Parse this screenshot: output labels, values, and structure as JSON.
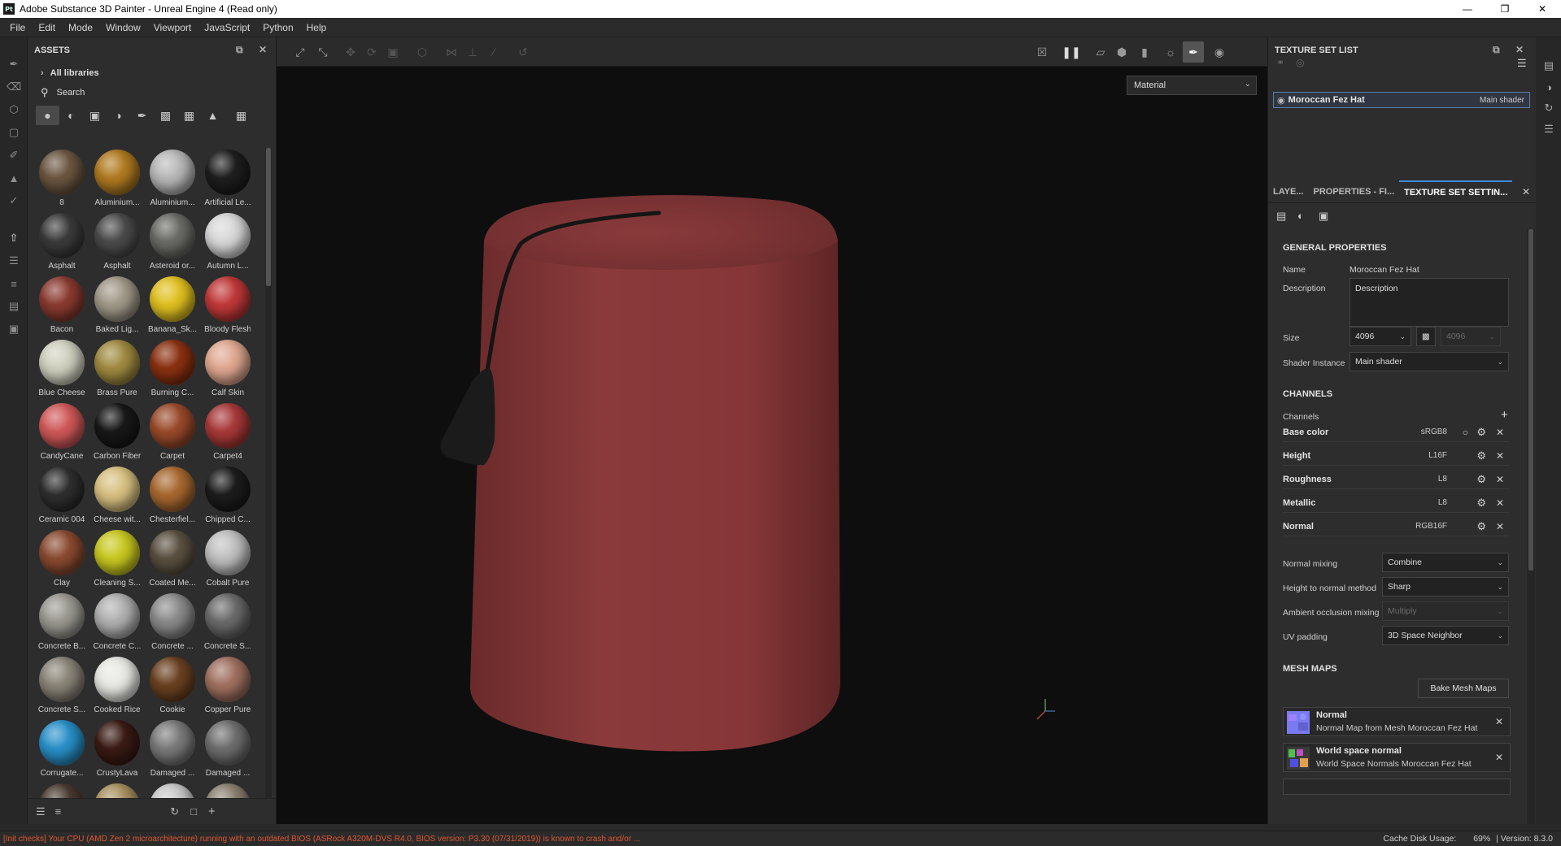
{
  "window": {
    "title": "Adobe Substance 3D Painter - Unreal Engine 4 (Read only)",
    "app_icon": "Pt"
  },
  "menu": [
    "File",
    "Edit",
    "Mode",
    "Window",
    "Viewport",
    "JavaScript",
    "Python",
    "Help"
  ],
  "assets": {
    "title": "ASSETS",
    "library": "All libraries",
    "search_placeholder": "Search",
    "materials": [
      {
        "label": "8",
        "color": "#6b5540"
      },
      {
        "label": "Aluminium...",
        "color": "#b07a20"
      },
      {
        "label": "Aluminium...",
        "color": "#b8b8b8"
      },
      {
        "label": "Artificial Le...",
        "color": "#1e1e1e"
      },
      {
        "label": "Asphalt",
        "color": "#3a3a3a"
      },
      {
        "label": "Asphalt",
        "color": "#4a4a4a"
      },
      {
        "label": "Asteroid or...",
        "color": "#6a6a66"
      },
      {
        "label": "Autumn L...",
        "color": "#d8d8d8"
      },
      {
        "label": "Bacon",
        "color": "#8a3a30"
      },
      {
        "label": "Baked Lig...",
        "color": "#a09888"
      },
      {
        "label": "Banana_Sk...",
        "color": "#e0c020"
      },
      {
        "label": "Bloody Flesh",
        "color": "#c03838"
      },
      {
        "label": "Blue Cheese",
        "color": "#d0d0c0"
      },
      {
        "label": "Brass Pure",
        "color": "#a08a40"
      },
      {
        "label": "Burning C...",
        "color": "#8a3010"
      },
      {
        "label": "Calf Skin",
        "color": "#e0a890"
      },
      {
        "label": "CandyCane",
        "color": "#d05858"
      },
      {
        "label": "Carbon Fiber",
        "color": "#181818"
      },
      {
        "label": "Carpet",
        "color": "#9a4a2a"
      },
      {
        "label": "Carpet4",
        "color": "#a83838"
      },
      {
        "label": "Ceramic 004",
        "color": "#2e2e2e"
      },
      {
        "label": "Cheese wit...",
        "color": "#d8c080"
      },
      {
        "label": "Chesterfiel...",
        "color": "#a86830"
      },
      {
        "label": "Chipped C...",
        "color": "#1c1c1c"
      },
      {
        "label": "Clay",
        "color": "#8a4a30"
      },
      {
        "label": "Cleaning S...",
        "color": "#c8c820"
      },
      {
        "label": "Coated Me...",
        "color": "#5a5040"
      },
      {
        "label": "Cobalt Pure",
        "color": "#c0c0c0"
      },
      {
        "label": "Concrete B...",
        "color": "#9a9890"
      },
      {
        "label": "Concrete C...",
        "color": "#b0b0b0"
      },
      {
        "label": "Concrete ...",
        "color": "#8a8a8a"
      },
      {
        "label": "Concrete S...",
        "color": "#6a6a6a"
      },
      {
        "label": "Concrete S...",
        "color": "#8a8478"
      },
      {
        "label": "Cooked Rice",
        "color": "#e8e8e4"
      },
      {
        "label": "Cookie",
        "color": "#6a4020"
      },
      {
        "label": "Copper Pure",
        "color": "#a07060"
      },
      {
        "label": "Corrugate...",
        "color": "#2890c8"
      },
      {
        "label": "CrustyLava",
        "color": "#3a1a14"
      },
      {
        "label": "Damaged ...",
        "color": "#7a7a7a"
      },
      {
        "label": "Damaged ...",
        "color": "#6e6e6e"
      },
      {
        "label": "",
        "color": "#4a3a30"
      },
      {
        "label": "",
        "color": "#a89060"
      },
      {
        "label": "",
        "color": "#c8c8c8"
      },
      {
        "label": "",
        "color": "#8a8070"
      }
    ]
  },
  "viewport": {
    "mode": "Material"
  },
  "texture_set_list": {
    "title": "TEXTURE SET LIST",
    "item_name": "Moroccan Fez Hat",
    "item_shader": "Main shader"
  },
  "tabs": [
    "LAYE...",
    "PROPERTIES - FI...",
    "TEXTURE SET SETTIN..."
  ],
  "settings": {
    "general_title": "GENERAL PROPERTIES",
    "name_label": "Name",
    "name_value": "Moroccan Fez Hat",
    "desc_label": "Description",
    "desc_value": "Description",
    "size_label": "Size",
    "size_value": "4096",
    "size_value2": "4096",
    "shader_label": "Shader Instance",
    "shader_value": "Main shader",
    "channels_title": "CHANNELS",
    "channels_label": "Channels",
    "channels": [
      {
        "name": "Base color",
        "format": "sRGB8"
      },
      {
        "name": "Height",
        "format": "L16F"
      },
      {
        "name": "Roughness",
        "format": "L8"
      },
      {
        "name": "Metallic",
        "format": "L8"
      },
      {
        "name": "Normal",
        "format": "RGB16F"
      }
    ],
    "normal_mixing_label": "Normal mixing",
    "normal_mixing_value": "Combine",
    "h2n_label": "Height to normal method",
    "h2n_value": "Sharp",
    "ao_label": "Ambient occlusion mixing",
    "ao_value": "Multiply",
    "uv_label": "UV padding",
    "uv_value": "3D Space Neighbor",
    "mesh_title": "MESH MAPS",
    "bake_button": "Bake Mesh Maps",
    "mesh_maps": [
      {
        "title": "Normal",
        "sub": "Normal Map from Mesh Moroccan Fez Hat"
      },
      {
        "title": "World space normal",
        "sub": "World Space Normals Moroccan Fez Hat"
      }
    ]
  },
  "status": {
    "error": "[Init checks] Your CPU (AMD Zen 2 microarchitecture) running with an outdated BIOS (ASRock A320M-DVS R4.0, BIOS version: P3.30 (07/31/2019)) is known to crash and/or ...",
    "cache_label": "Cache Disk Usage:",
    "cache_value": "69%",
    "version": "| Version: 8.3.0"
  }
}
